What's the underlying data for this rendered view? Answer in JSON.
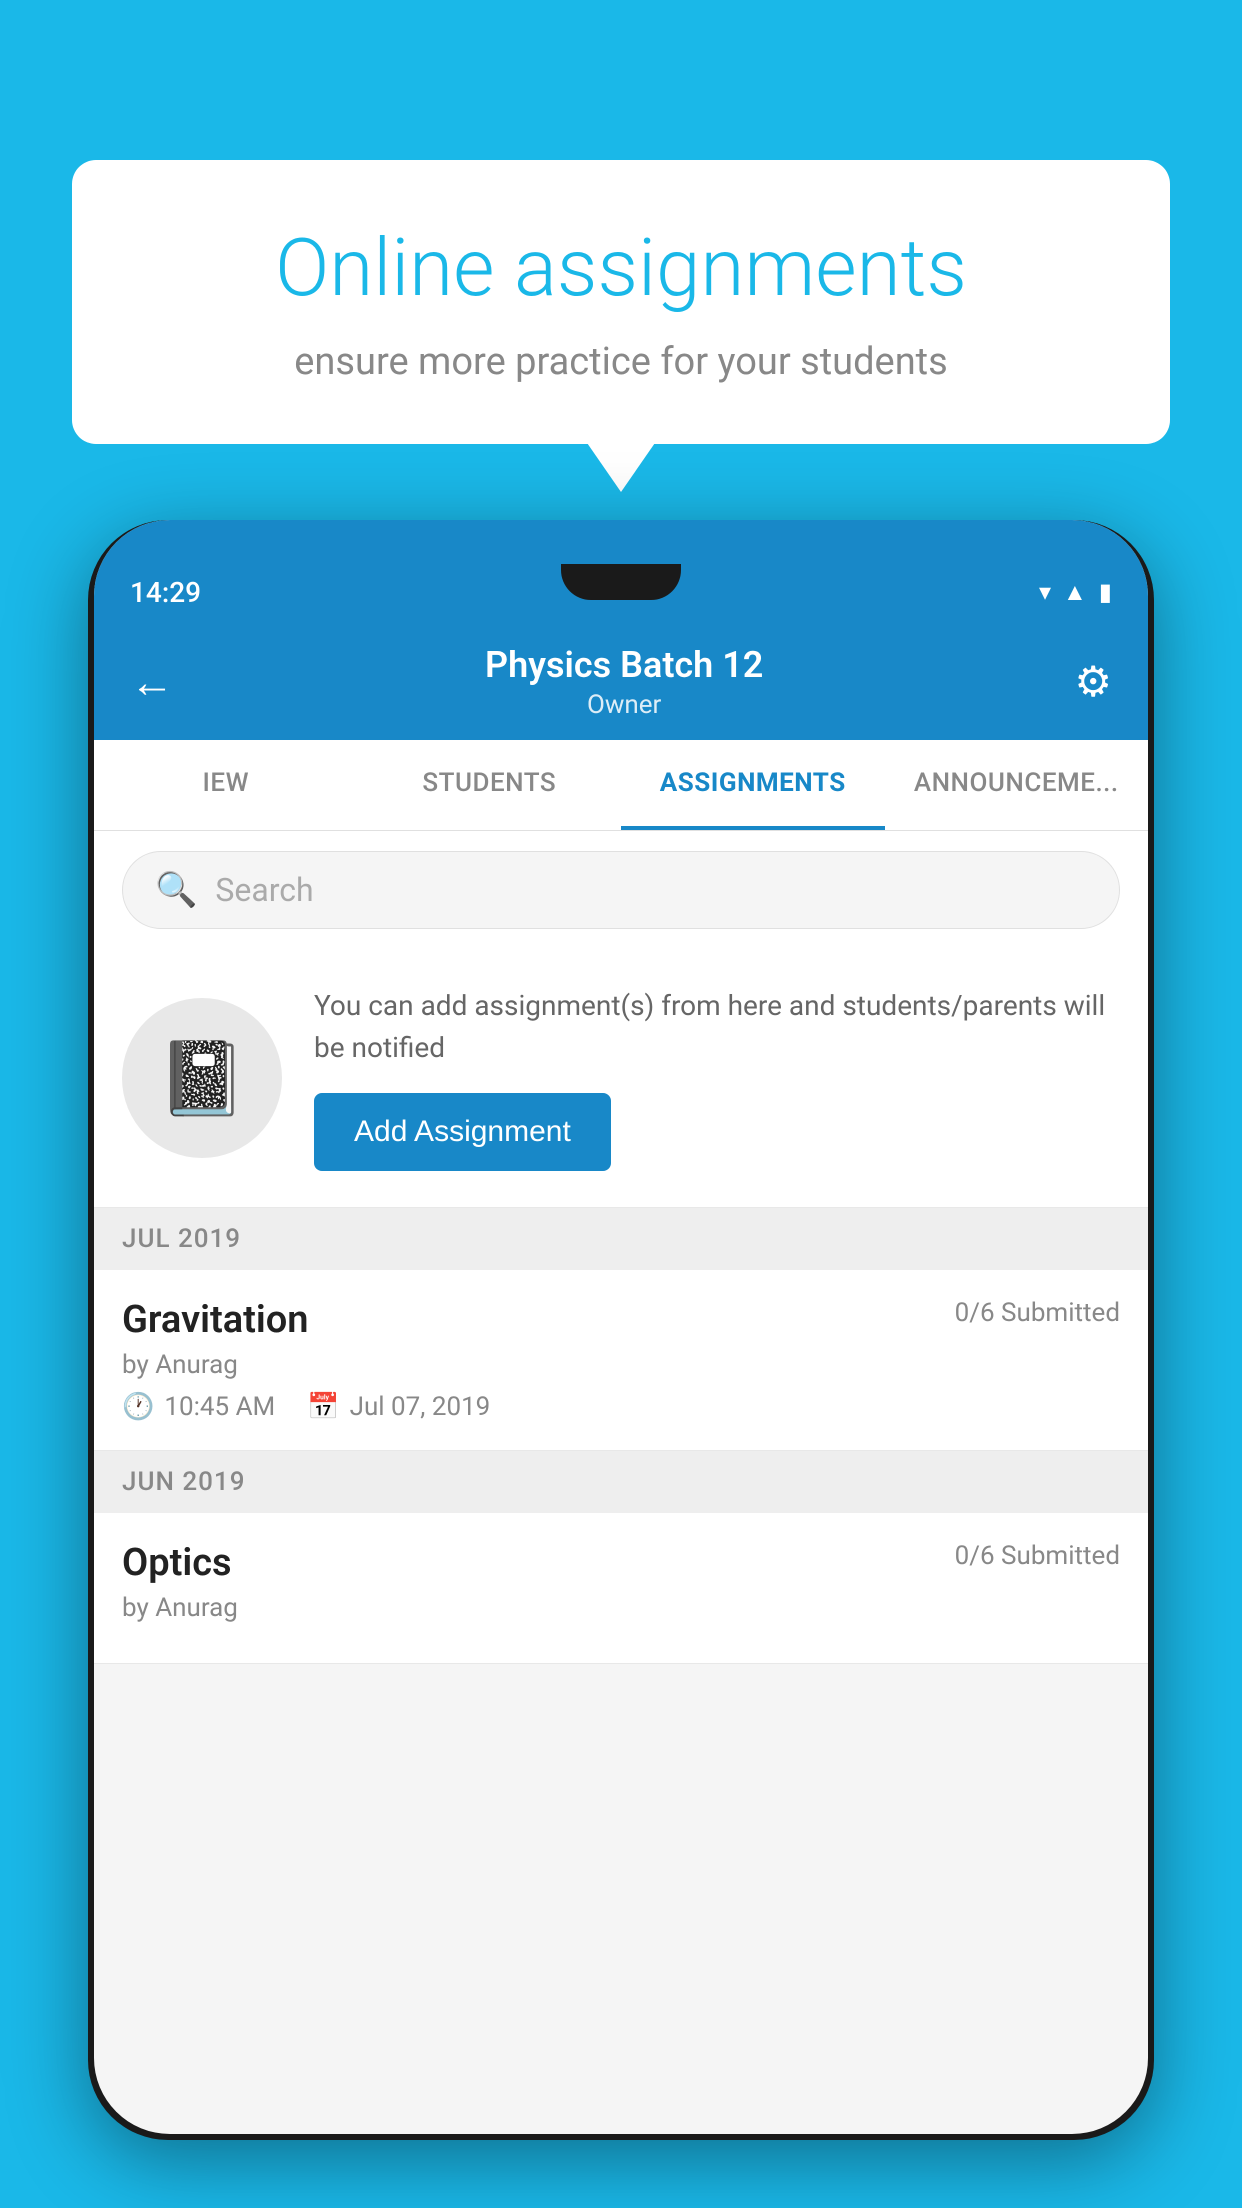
{
  "background_color": "#1ab8e8",
  "speech_bubble": {
    "title": "Online assignments",
    "subtitle": "ensure more practice for your students"
  },
  "status_bar": {
    "time": "14:29",
    "wifi_icon": "▾",
    "signal_icon": "▲",
    "battery_icon": "▮"
  },
  "app_header": {
    "title": "Physics Batch 12",
    "subtitle": "Owner",
    "back_label": "←",
    "gear_label": "⚙"
  },
  "tabs": [
    {
      "label": "IEW",
      "active": false
    },
    {
      "label": "STUDENTS",
      "active": false
    },
    {
      "label": "ASSIGNMENTS",
      "active": true
    },
    {
      "label": "ANNOUNCEMENTS",
      "active": false
    }
  ],
  "search": {
    "placeholder": "Search"
  },
  "promo": {
    "text": "You can add assignment(s) from here and students/parents will be notified",
    "button_label": "Add Assignment"
  },
  "sections": [
    {
      "header": "JUL 2019",
      "assignments": [
        {
          "name": "Gravitation",
          "submitted": "0/6 Submitted",
          "by": "by Anurag",
          "time": "10:45 AM",
          "date": "Jul 07, 2019"
        }
      ]
    },
    {
      "header": "JUN 2019",
      "assignments": [
        {
          "name": "Optics",
          "submitted": "0/6 Submitted",
          "by": "by Anurag",
          "time": "",
          "date": ""
        }
      ]
    }
  ]
}
